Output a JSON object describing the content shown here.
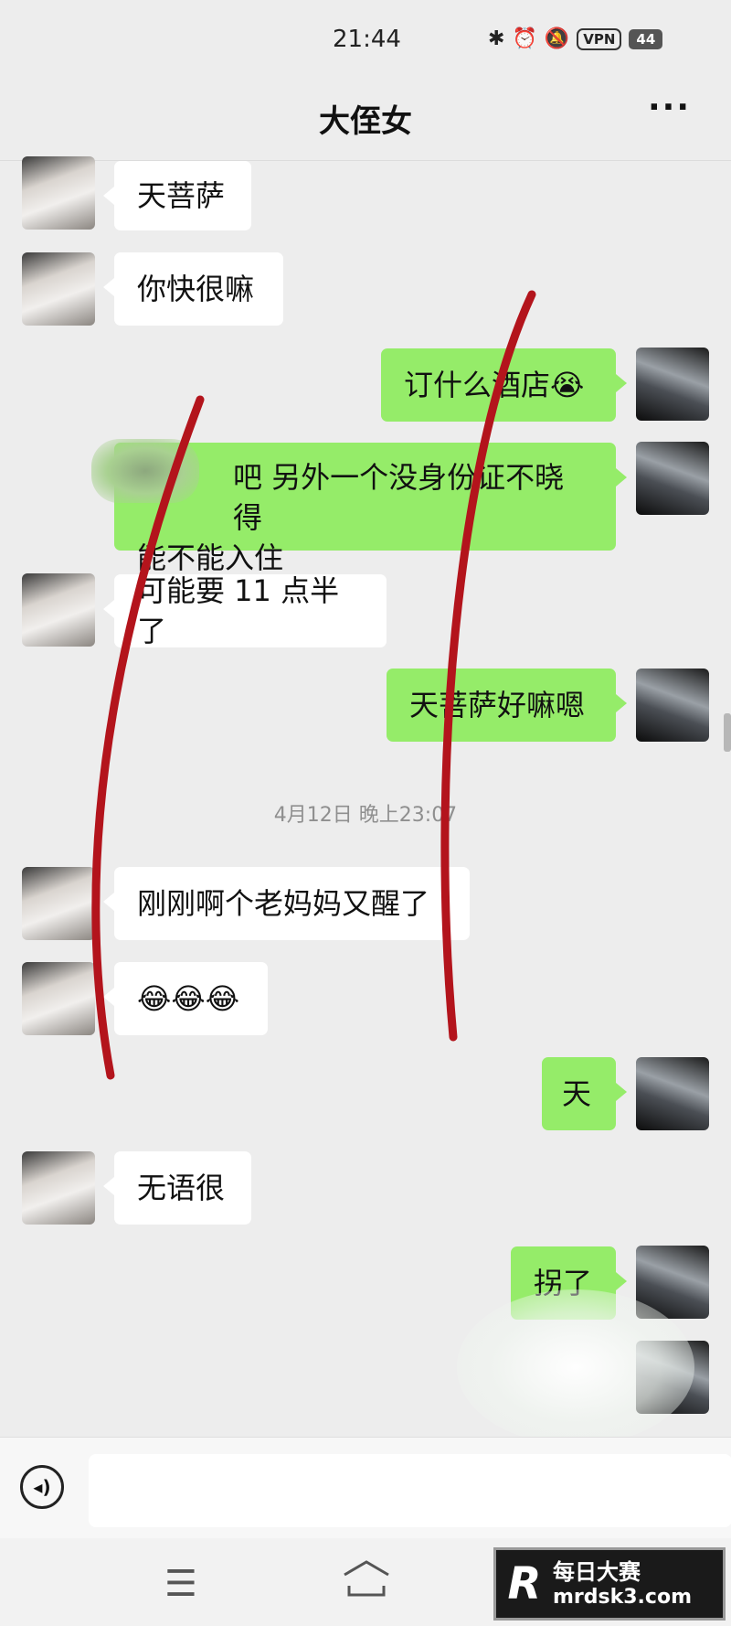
{
  "status_bar": {
    "time": "21:44",
    "vpn": "VPN",
    "battery": "44"
  },
  "header": {
    "title": "大侄女",
    "more": "···"
  },
  "messages": [
    {
      "text": "天菩萨"
    },
    {
      "text": "你快很嘛"
    },
    {
      "text": "订什么酒店😭"
    },
    {
      "line1": "吧 另外一个没身份证不晓得",
      "line2": "能不能入住"
    },
    {
      "text": "可能要 11 点半了"
    },
    {
      "text": "天菩萨好嘛嗯"
    },
    {
      "text": "刚刚啊个老妈妈又醒了"
    },
    {
      "text": "😂😂😂"
    },
    {
      "text": "天"
    },
    {
      "text": "无语很"
    },
    {
      "text": "拐了"
    }
  ],
  "timestamp": "4月12日 晚上23:07",
  "input": {
    "placeholder": ""
  },
  "watermark": {
    "logo": "R",
    "line1": "每日大赛",
    "line2": "mrdsk3.com"
  }
}
